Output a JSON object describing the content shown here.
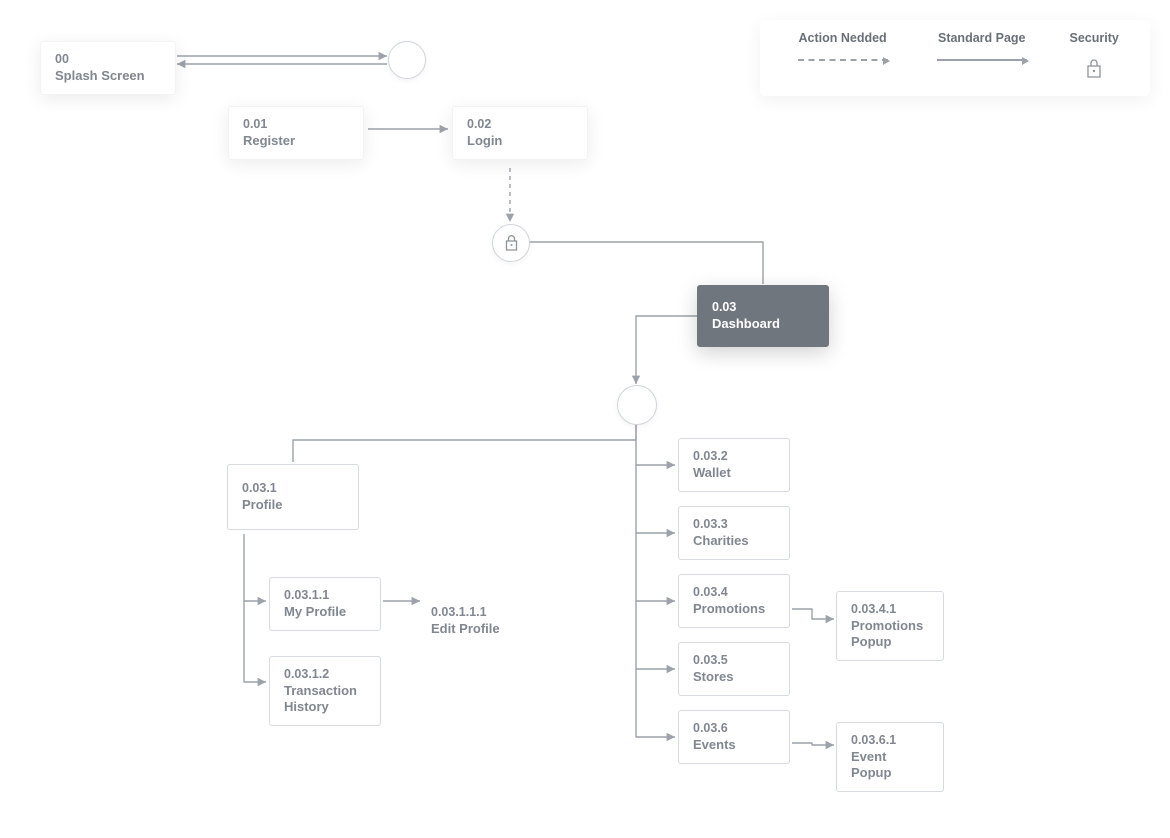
{
  "legend": {
    "action_label": "Action Nedded",
    "standard_label": "Standard Page",
    "security_label": "Security"
  },
  "nodes": {
    "splash": {
      "code": "00",
      "title": "Splash Screen"
    },
    "register": {
      "code": "0.01",
      "title": "Register"
    },
    "login": {
      "code": "0.02",
      "title": "Login"
    },
    "dashboard": {
      "code": "0.03",
      "title": "Dashboard"
    },
    "profile": {
      "code": "0.03.1",
      "title": "Profile"
    },
    "myprofile": {
      "code": "0.03.1.1",
      "title": "My Profile"
    },
    "editprofile": {
      "code": "0.03.1.1.1",
      "title": "Edit Profile"
    },
    "txhistory": {
      "code": "0.03.1.2",
      "title": "Transaction History"
    },
    "wallet": {
      "code": "0.03.2",
      "title": "Wallet"
    },
    "charities": {
      "code": "0.03.3",
      "title": "Charities"
    },
    "promotions": {
      "code": "0.03.4",
      "title": "Promotions"
    },
    "promopopup": {
      "code": "0.03.4.1",
      "title": "Promotions Popup"
    },
    "stores": {
      "code": "0.03.5",
      "title": "Stores"
    },
    "events": {
      "code": "0.03.6",
      "title": "Events"
    },
    "eventpopup": {
      "code": "0.03.6.1",
      "title": "Event Popup"
    }
  },
  "chart_data": {
    "type": "flow-sitemap",
    "edges": [
      {
        "from": "splash",
        "to": "register",
        "style": "solid",
        "dir": "both"
      },
      {
        "from": "register",
        "to": "login",
        "style": "solid"
      },
      {
        "from": "login",
        "to": "security",
        "style": "dashed"
      },
      {
        "from": "security",
        "to": "dashboard",
        "style": "solid"
      },
      {
        "from": "dashboard",
        "to": "profile",
        "style": "solid"
      },
      {
        "from": "dashboard",
        "to": "wallet",
        "style": "solid"
      },
      {
        "from": "dashboard",
        "to": "charities",
        "style": "solid"
      },
      {
        "from": "dashboard",
        "to": "promotions",
        "style": "solid"
      },
      {
        "from": "dashboard",
        "to": "stores",
        "style": "solid"
      },
      {
        "from": "dashboard",
        "to": "events",
        "style": "solid"
      },
      {
        "from": "profile",
        "to": "myprofile",
        "style": "solid"
      },
      {
        "from": "profile",
        "to": "txhistory",
        "style": "solid"
      },
      {
        "from": "myprofile",
        "to": "editprofile",
        "style": "solid"
      },
      {
        "from": "promotions",
        "to": "promopopup",
        "style": "solid"
      },
      {
        "from": "events",
        "to": "eventpopup",
        "style": "solid"
      }
    ],
    "decorations": [
      "junction-circle-top",
      "junction-circle-mid",
      "security-lock-node"
    ]
  }
}
